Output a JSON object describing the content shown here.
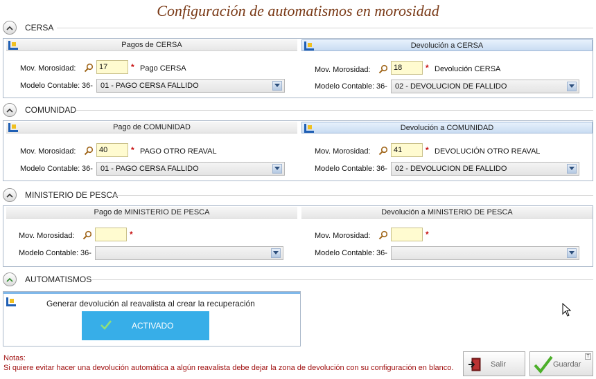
{
  "title": "Configuración de automatismos en morosidad",
  "sections": [
    {
      "label": "CERSA",
      "left": {
        "header": "Pagos de CERSA",
        "mov_label": "Mov. Morosidad:",
        "mov_value": "17",
        "mov_desc": "Pago CERSA",
        "modelo_label": "Modelo Contable:",
        "modelo_prefix": "36-",
        "modelo_value": "01 - PAGO CERSA FALLIDO"
      },
      "right": {
        "header": "Devolución a CERSA",
        "mov_label": "Mov. Morosidad:",
        "mov_value": "18",
        "mov_desc": "Devolución CERSA",
        "modelo_label": "Modelo Contable:",
        "modelo_prefix": "36-",
        "modelo_value": "02 - DEVOLUCION DE FALLIDO"
      }
    },
    {
      "label": "COMUNIDAD",
      "left": {
        "header": "Pago de COMUNIDAD",
        "mov_label": "Mov. Morosidad:",
        "mov_value": "40",
        "mov_desc": "PAGO OTRO REAVAL",
        "modelo_label": "Modelo Contable:",
        "modelo_prefix": "36-",
        "modelo_value": "01 - PAGO CERSA FALLIDO"
      },
      "right": {
        "header": "Devolución a COMUNIDAD",
        "mov_label": "Mov. Morosidad:",
        "mov_value": "41",
        "mov_desc": "DEVOLUCIÓN OTRO REAVAL",
        "modelo_label": "Modelo Contable:",
        "modelo_prefix": "36-",
        "modelo_value": "02 - DEVOLUCION DE FALLIDO"
      }
    },
    {
      "label": "MINISTERIO DE PESCA",
      "left": {
        "header": "Pago de MINISTERIO DE PESCA",
        "mov_label": "Mov. Morosidad:",
        "mov_value": "",
        "mov_desc": "",
        "modelo_label": "Modelo Contable:",
        "modelo_prefix": "36-",
        "modelo_value": ""
      },
      "right": {
        "header": "Devolución a MINISTERIO DE PESCA",
        "mov_label": "Mov. Morosidad:",
        "mov_value": "",
        "mov_desc": "",
        "modelo_label": "Modelo Contable:",
        "modelo_prefix": "36-",
        "modelo_value": ""
      }
    }
  ],
  "automatismos": {
    "label": "AUTOMATISMOS",
    "text": "Generar devolución al reavalista al crear la recuperación",
    "toggle_label": "ACTIVADO"
  },
  "notes": {
    "title": "Notas:",
    "text": "Si quiere evitar hacer una devolución automática a algún reavalista debe dejar la zona de devolución con su configuración en blanco."
  },
  "buttons": {
    "salir": "Salir",
    "guardar": "Guardar"
  },
  "colors": {
    "title": "#7a3a17",
    "required": "#c81010",
    "input_bg": "#fffbd0",
    "activado_bg": "#37aee8",
    "notes": "#a01010"
  }
}
